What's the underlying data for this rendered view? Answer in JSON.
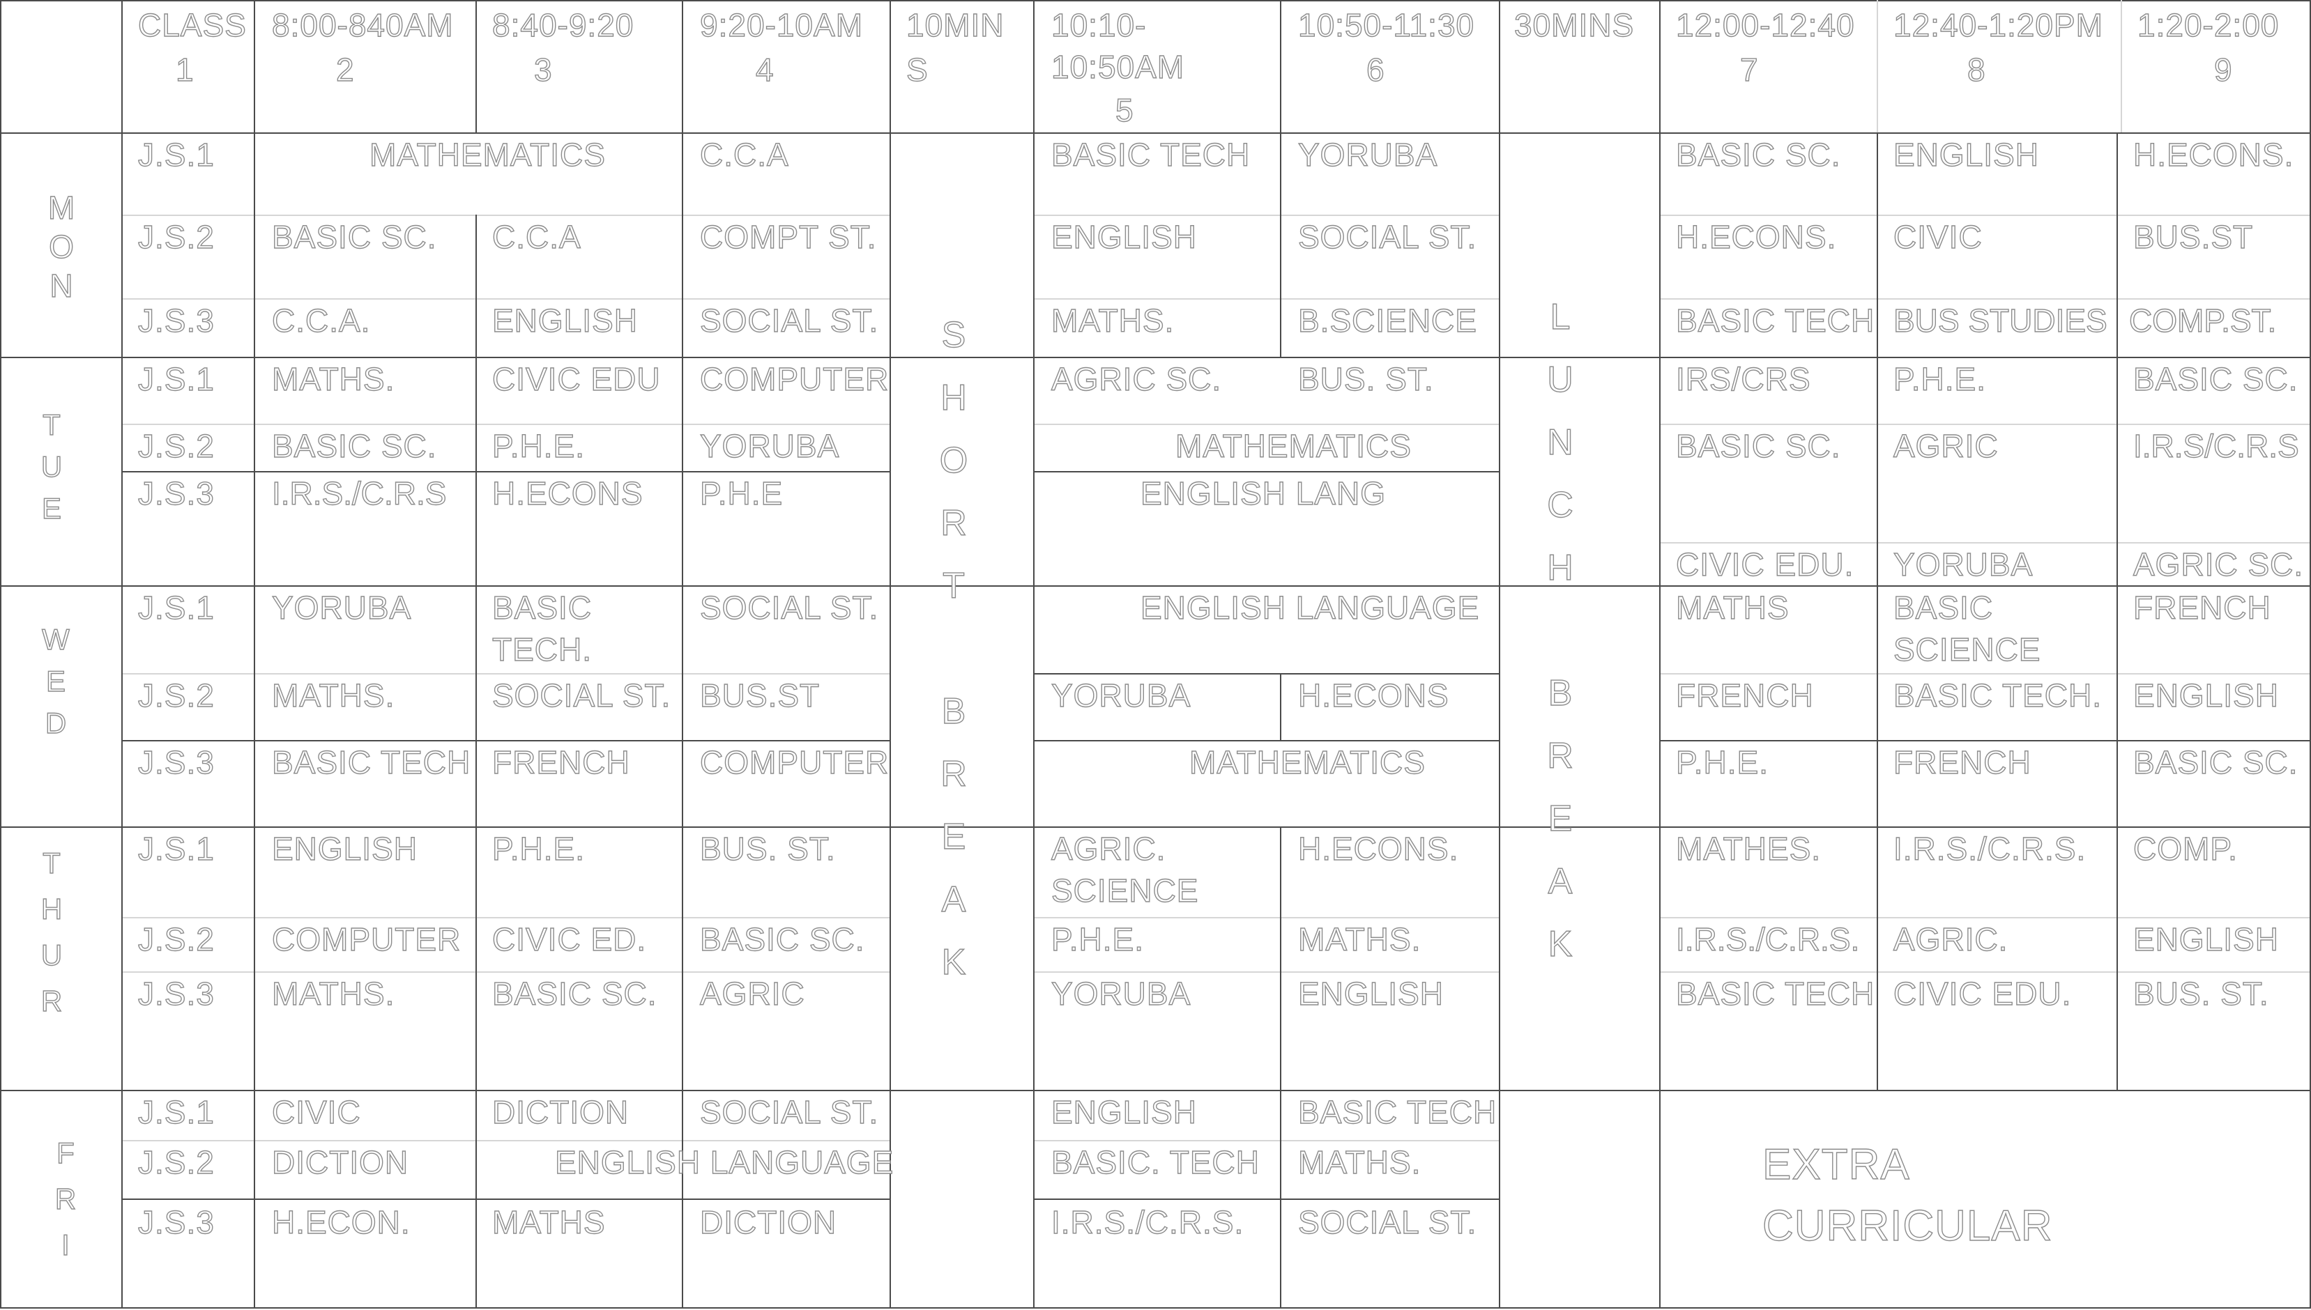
{
  "header": {
    "class": [
      "CLASS",
      "1"
    ],
    "p2": [
      "8:00-840AM",
      "2"
    ],
    "p3": [
      "8:40-9:20",
      "3"
    ],
    "p4": [
      "9:20-10AM",
      "4"
    ],
    "p_short": [
      "10MIN",
      "S"
    ],
    "p5": [
      "10:10-",
      "10:50AM",
      "5"
    ],
    "p6": [
      "10:50-11:30",
      "6"
    ],
    "p_lunch": [
      "30MINS"
    ],
    "p7": [
      "12:00-12:40",
      "7"
    ],
    "p8": [
      "12:40-1:20PM",
      "8"
    ],
    "p9": [
      "1:20-2:00",
      "9"
    ]
  },
  "days": {
    "mon": [
      "M",
      "O",
      "N"
    ],
    "tue": [
      "T",
      "U",
      "E"
    ],
    "wed": [
      "W",
      "E",
      "D"
    ],
    "thur": [
      "T",
      "H",
      "U",
      "R"
    ],
    "fri": [
      "F",
      "R",
      "I"
    ]
  },
  "breaks": {
    "short": [
      "S",
      "H",
      "O",
      "R",
      "T",
      "",
      "B",
      "R",
      "E",
      "A",
      "K"
    ],
    "lunch": [
      "L",
      "U",
      "N",
      "C",
      "H",
      "",
      "B",
      "R",
      "E",
      "A",
      "K"
    ]
  },
  "rows": {
    "mon_js1": {
      "class": "J.S.1",
      "p23": "MATHEMATICS",
      "p4": "C.C.A",
      "p5": "BASIC TECH",
      "p6": "YORUBA",
      "p7": "BASIC SC.",
      "p8": "ENGLISH",
      "p9": "H.ECONS."
    },
    "mon_js2": {
      "class": "J.S.2",
      "p2": "BASIC SC.",
      "p3": "C.C.A",
      "p4": "COMPT ST.",
      "p5": "ENGLISH",
      "p6": "SOCIAL ST.",
      "p7": "H.ECONS.",
      "p8": "CIVIC",
      "p9": "BUS.ST"
    },
    "mon_js3": {
      "class": "J.S.3",
      "p2": "C.C.A.",
      "p3": "ENGLISH",
      "p4": "SOCIAL ST.",
      "p5": "MATHS.",
      "p6": "B.SCIENCE",
      "p7": "BASIC TECH",
      "p8": "BUS STUDIES",
      "p9": "COMP.ST."
    },
    "tue_js1": {
      "class": "J.S.1",
      "p2": "MATHS.",
      "p3": "CIVIC EDU",
      "p4": "COMPUTER",
      "p5": "AGRIC SC.",
      "p6": "BUS. ST.",
      "p7": "IRS/CRS",
      "p8": "P.H.E.",
      "p9": "BASIC SC."
    },
    "tue_js2": {
      "class": "J.S.2",
      "p2": "BASIC SC.",
      "p3": "P.H.E.",
      "p4": "YORUBA",
      "p56": "MATHEMATICS",
      "p7": "BASIC SC.",
      "p8": "AGRIC",
      "p9": "I.R.S/C.R.S"
    },
    "tue_js3": {
      "class": "J.S.3",
      "p2": "I.R.S./C.R.S",
      "p3": "H.ECONS",
      "p4": "P.H.E",
      "p56": "ENGLISH LANG",
      "p7": "CIVIC EDU.",
      "p8": "YORUBA",
      "p9": "AGRIC SC."
    },
    "wed_js1": {
      "class": "J.S.1",
      "p2": "YORUBA",
      "p3": "BASIC TECH.",
      "p4": "SOCIAL ST.",
      "p56": "ENGLISH LANGUAGE",
      "p7": "MATHS",
      "p8": "BASIC SCIENCE",
      "p9": "FRENCH"
    },
    "wed_js2": {
      "class": "J.S.2",
      "p2": "MATHS.",
      "p3": "SOCIAL ST.",
      "p4": "BUS.ST",
      "p5": "YORUBA",
      "p6": "H.ECONS",
      "p7": "FRENCH",
      "p8": "BASIC TECH.",
      "p9": "ENGLISH"
    },
    "wed_js3": {
      "class": "J.S.3",
      "p2": "BASIC TECH",
      "p3": "FRENCH",
      "p4": "COMPUTER",
      "p56": "MATHEMATICS",
      "p7": "P.H.E.",
      "p8": "FRENCH",
      "p9": "BASIC SC."
    },
    "thu_js1": {
      "class": "J.S.1",
      "p2": "ENGLISH",
      "p3": "P.H.E.",
      "p4": "BUS. ST.",
      "p5": "AGRIC. SCIENCE",
      "p6": "H.ECONS.",
      "p7": "MATHES.",
      "p8": "I.R.S./C.R.S.",
      "p9": "COMP."
    },
    "thu_js2": {
      "class": "J.S.2",
      "p2": "COMPUTER",
      "p3": "CIVIC ED.",
      "p4": "BASIC SC.",
      "p5": "P.H.E.",
      "p6": "MATHS.",
      "p7": "I.R.S./C.R.S.",
      "p8": "AGRIC.",
      "p9": "ENGLISH"
    },
    "thu_js3": {
      "class": "J.S.3",
      "p2": "MATHS.",
      "p3": "BASIC SC.",
      "p4": "AGRIC",
      "p5": "YORUBA",
      "p6": "ENGLISH",
      "p7": "BASIC TECH",
      "p8": "CIVIC EDU.",
      "p9": "BUS. ST."
    },
    "fri_js1": {
      "class": "J.S.1",
      "p2": "CIVIC",
      "p3": "DICTION",
      "p4": "SOCIAL ST.",
      "p5": "ENGLISH",
      "p6": "BASIC TECH"
    },
    "fri_js2": {
      "class": "J.S.2",
      "p2": "DICTION",
      "p34": "ENGLISH LANGUAGE",
      "p5": "BASIC. TECH",
      "p6": "MATHS."
    },
    "fri_js3": {
      "class": "J.S.3",
      "p2": "H.ECON.",
      "p3": "MATHS",
      "p4": "DICTION",
      "p5": "I.R.S./C.R.S.",
      "p6": "SOCIAL ST."
    }
  },
  "extra_curricular": [
    "EXTRA",
    "CURRICULAR"
  ]
}
